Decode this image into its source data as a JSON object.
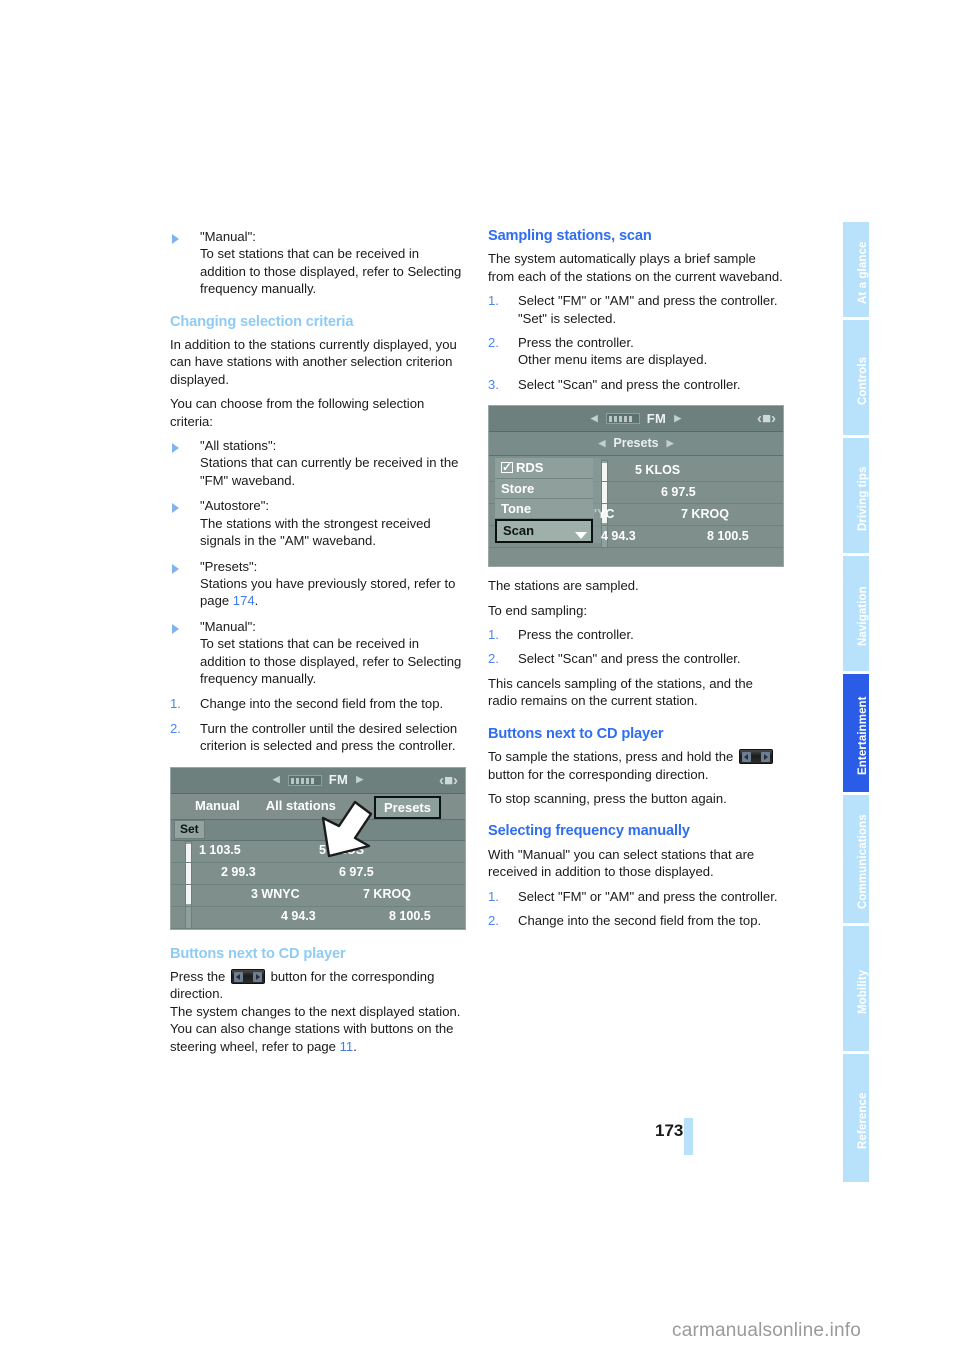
{
  "page": {
    "number": "173",
    "watermark": "carmanualsonline.info"
  },
  "sidebar": {
    "tabs": [
      {
        "label": "At a glance",
        "active": false
      },
      {
        "label": "Controls",
        "active": false
      },
      {
        "label": "Driving tips",
        "active": false
      },
      {
        "label": "Navigation",
        "active": false
      },
      {
        "label": "Entertainment",
        "active": true
      },
      {
        "label": "Communications",
        "active": false
      },
      {
        "label": "Mobility",
        "active": false
      },
      {
        "label": "Reference",
        "active": false
      }
    ],
    "colors": {
      "inactive_bg": "#b8e2fb",
      "active_bg": "#2b5ce8",
      "text": "#ffffff"
    }
  },
  "left_column": {
    "intro_bullet": {
      "title": "\"Manual\":",
      "body": "To set stations that can be received in addition to those displayed, refer to Selecting frequency manually."
    },
    "heading_changing": "Changing selection criteria",
    "para_1": "In addition to the stations currently displayed, you can have stations with another selection criterion displayed.",
    "para_2": "You can choose from the following selection criteria:",
    "criteria": [
      {
        "title": "\"All stations\":",
        "body": "Stations that can currently be received in the \"FM\" waveband."
      },
      {
        "title": "\"Autostore\":",
        "body": "The stations with the strongest received signals in the \"AM\" waveband."
      },
      {
        "title": "\"Presets\":",
        "body_pre": "Stations you have previously stored, refer to page ",
        "page_ref": "174",
        "body_post": "."
      },
      {
        "title": "\"Manual\":",
        "body": "To set stations that can be received in addition to those displayed, refer to Selecting frequency manually."
      }
    ],
    "steps": [
      {
        "num": "1.",
        "text": "Change into the second field from the top."
      },
      {
        "num": "2.",
        "text": "Turn the controller until the desired selection criterion is selected and press the controller."
      }
    ],
    "heading_buttons": "Buttons next to CD player",
    "buttons_text_pre": "Press the ",
    "buttons_text_post": " button for the corresponding direction.",
    "buttons_line2": "The system changes to the next displayed station.",
    "buttons_line3_pre": "You can also change stations with buttons on the steering wheel, refer to page ",
    "buttons_line3_ref": "11",
    "buttons_line3_post": "."
  },
  "right_column": {
    "heading_sampling": "Sampling stations, scan",
    "para_1": "The system automatically plays a brief sample from each of the stations on the current waveband.",
    "steps_start": [
      {
        "num": "1.",
        "line1": "Select \"FM\" or \"AM\" and press the controller.",
        "line2": "\"Set\" is selected."
      },
      {
        "num": "2.",
        "line1": "Press the controller.",
        "line2": "Other menu items are displayed."
      },
      {
        "num": "3.",
        "line1": "Select \"Scan\" and press the controller.",
        "line2": ""
      }
    ],
    "after_fig_1": "The stations are sampled.",
    "after_fig_2": "To end sampling:",
    "steps_end": [
      {
        "num": "1.",
        "text": "Press the controller."
      },
      {
        "num": "2.",
        "text": "Select \"Scan\" and press the controller."
      }
    ],
    "cancel_text": "This cancels sampling of the stations, and the radio remains on the current station.",
    "heading_buttons": "Buttons next to CD player",
    "buttons_text_pre": "To sample the stations, press and hold the ",
    "buttons_text_post": " button for the corresponding direction.",
    "buttons_line2": "To stop scanning, press the button again.",
    "heading_selecting": "Selecting frequency manually",
    "selecting_para": "With \"Manual\" you can select stations that are received in addition to those displayed.",
    "selecting_steps": [
      {
        "num": "1.",
        "text": "Select \"FM\" or \"AM\" and press the controller."
      },
      {
        "num": "2.",
        "text": "Change into the second field from the top."
      }
    ]
  },
  "figure_presets": {
    "band": "FM",
    "tabs": [
      "Manual",
      "All stations",
      "Presets"
    ],
    "selected_tab": "Presets",
    "set_label": "Set",
    "presets": [
      {
        "left": "1 103.5",
        "right": "5 KLOS"
      },
      {
        "left": "2 99.3",
        "right": "6 97.5"
      },
      {
        "left": "3 WNYC",
        "right": "7 KROQ"
      },
      {
        "left": "4 94.3",
        "right": "8 100.5"
      }
    ]
  },
  "figure_scan": {
    "band": "FM",
    "subtitle": "Presets",
    "menu": [
      {
        "label": "RDS",
        "checkbox": true,
        "selected": false
      },
      {
        "label": "Store",
        "checkbox": false,
        "selected": false
      },
      {
        "label": "Tone",
        "checkbox": false,
        "selected": false
      },
      {
        "label": "Scan",
        "checkbox": false,
        "selected": true
      }
    ],
    "presets": [
      {
        "left": "",
        "right": "5 KLOS"
      },
      {
        "left": "",
        "right": "6 97.5"
      },
      {
        "left": "N'YC",
        "right": "7 KROQ"
      },
      {
        "left": "4 94.3",
        "right": "8 100.5"
      }
    ]
  },
  "colors": {
    "heading_light_blue": "#8ecbf5",
    "heading_blue": "#2f6ef0",
    "page_ref_blue": "#3f7ce9",
    "list_number_blue": "#4d86ee"
  }
}
